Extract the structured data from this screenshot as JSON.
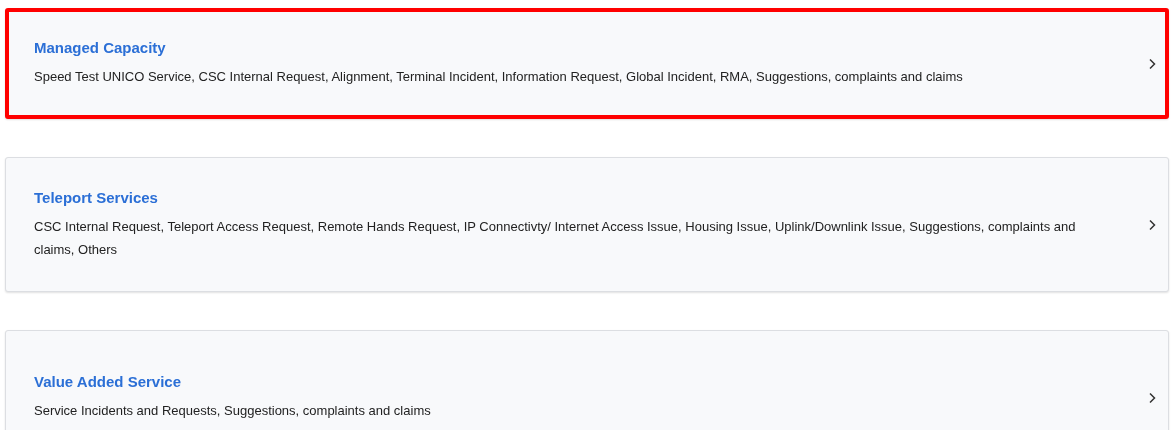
{
  "cards": [
    {
      "title": "Managed Capacity",
      "description": "Speed Test UNICO Service, CSC Internal Request, Alignment, Terminal Incident, Information Request, Global Incident, RMA, Suggestions, complaints and claims",
      "highlighted": true
    },
    {
      "title": "Teleport Services",
      "description": "CSC Internal Request, Teleport Access Request, Remote Hands Request, IP Connectivty/ Internet Access Issue, Housing Issue, Uplink/Downlink Issue, Suggestions, complaints and claims, Others",
      "highlighted": false
    },
    {
      "title": "Value Added Service",
      "description": "Service Incidents and Requests, Suggestions, complaints and claims",
      "highlighted": false
    }
  ]
}
